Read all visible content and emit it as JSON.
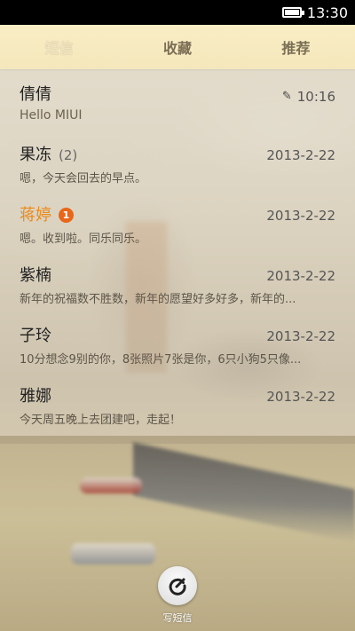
{
  "status_bar": {
    "time": "13:30",
    "battery_icon": "battery-icon"
  },
  "tabs": [
    {
      "label": "短信",
      "active": true
    },
    {
      "label": "收藏",
      "active": false
    },
    {
      "label": "推荐",
      "active": false
    }
  ],
  "messages": [
    {
      "name": "倩倩",
      "count": "",
      "badge": "",
      "time": "10:16",
      "preview": "Hello MIUI",
      "draft": true
    },
    {
      "name": "果冻",
      "count": "(2)",
      "badge": "",
      "time": "2013-2-22",
      "preview": "嗯，今天会回去的早点。"
    },
    {
      "name": "蒋婷",
      "count": "",
      "badge": "1",
      "time": "2013-2-22",
      "preview": "嗯。收到啦。同乐同乐。",
      "unread": true
    },
    {
      "name": "紫楠",
      "count": "",
      "badge": "",
      "time": "2013-2-22",
      "preview": "新年的祝福数不胜数，新年的愿望好多好多，新年的..."
    },
    {
      "name": "子玲",
      "count": "",
      "badge": "",
      "time": "2013-2-22",
      "preview": "10分想念9别的你，8张照片7张是你，6只小狗5只像..."
    },
    {
      "name": "雅娜",
      "count": "",
      "badge": "",
      "time": "2013-2-22",
      "preview": "今天周五晚上去团建吧，走起！"
    }
  ],
  "compose": {
    "label": "写短信",
    "icon": "compose-icon"
  },
  "colors": {
    "accent": "#e98a1c",
    "badge": "#e9661a",
    "tab_bar": "#f6e8ba"
  }
}
